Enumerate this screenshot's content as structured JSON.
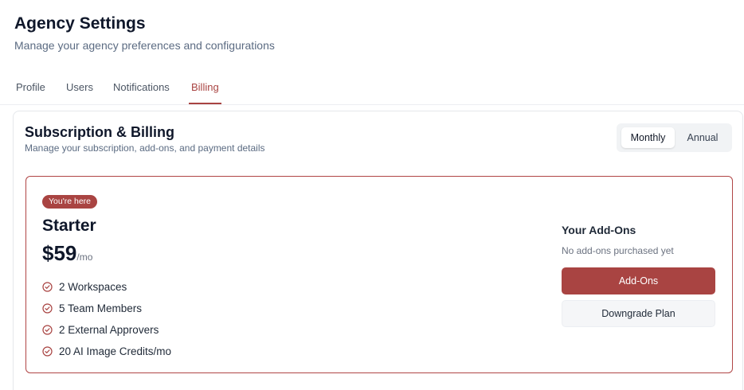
{
  "header": {
    "title": "Agency Settings",
    "subtitle": "Manage your agency preferences and configurations"
  },
  "tabs": [
    {
      "label": "Profile",
      "active": false
    },
    {
      "label": "Users",
      "active": false
    },
    {
      "label": "Notifications",
      "active": false
    },
    {
      "label": "Billing",
      "active": true
    }
  ],
  "billing": {
    "title": "Subscription & Billing",
    "subtitle": "Manage your subscription, add-ons, and payment details",
    "cycle_toggle": {
      "options": [
        "Monthly",
        "Annual"
      ],
      "selected": "Monthly"
    },
    "current_plan": {
      "badge": "You're here",
      "name": "Starter",
      "price": "$59",
      "period": "/mo",
      "features": [
        "2 Workspaces",
        "5 Team Members",
        "2 External Approvers",
        "20 AI Image Credits/mo"
      ],
      "feature_icon": "circle-check-icon"
    },
    "addons": {
      "title": "Your Add-Ons",
      "empty_text": "No add-ons purchased yet",
      "primary_button": "Add-Ons",
      "secondary_button": "Downgrade Plan"
    }
  },
  "colors": {
    "accent": "#a94442",
    "text_primary": "#0f172a",
    "text_muted": "#5b6b82",
    "toggle_bg": "#f1f3f5"
  }
}
